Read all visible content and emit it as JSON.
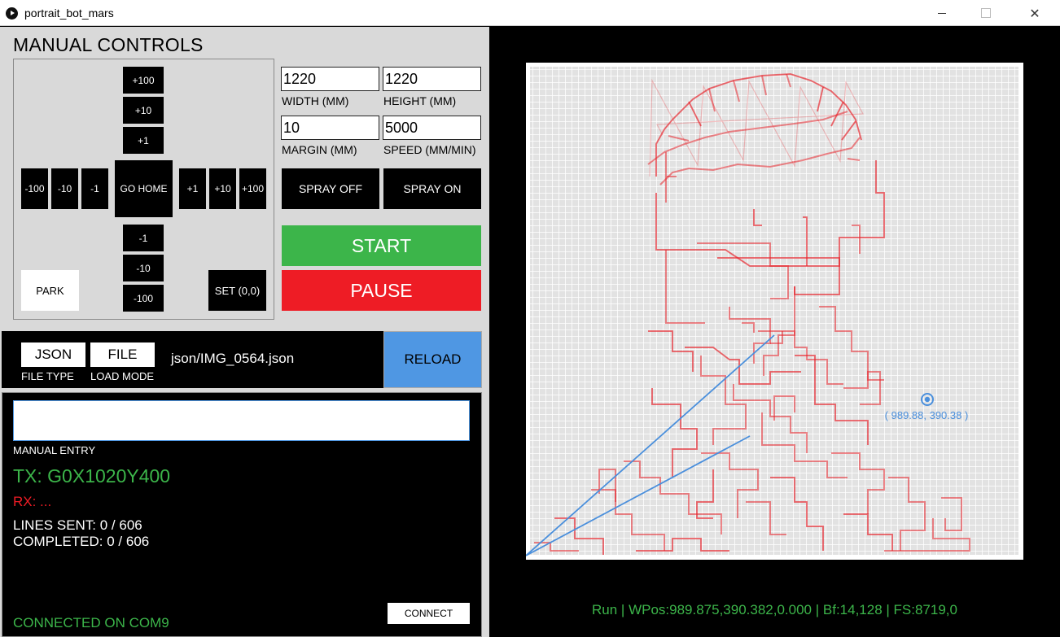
{
  "window": {
    "title": "portrait_bot_mars"
  },
  "manual": {
    "title": "MANUAL CONTROLS",
    "jog_up": [
      "+100",
      "+10",
      "+1"
    ],
    "jog_down": [
      "-1",
      "-10",
      "-100"
    ],
    "jog_left": [
      "-100",
      "-10",
      "-1"
    ],
    "jog_right": [
      "+1",
      "+10",
      "+100"
    ],
    "home_label": "GO HOME",
    "park_label": "PARK",
    "set_origin_label": "SET (0,0)"
  },
  "settings": {
    "width_value": "1220",
    "width_label": "WIDTH (MM)",
    "height_value": "1220",
    "height_label": "HEIGHT (MM)",
    "margin_value": "10",
    "margin_label": "MARGIN (MM)",
    "speed_value": "5000",
    "speed_label": "SPEED (MM/MIN)",
    "spray_off_label": "SPRAY OFF",
    "spray_on_label": "SPRAY ON",
    "start_label": "START",
    "pause_label": "PAUSE",
    "start_color": "#3cb54a",
    "pause_color": "#ee1c25"
  },
  "file": {
    "type_value": "JSON",
    "type_label": "FILE TYPE",
    "mode_value": "FILE",
    "mode_label": "LOAD MODE",
    "path": "json/IMG_0564.json",
    "reload_label": "RELOAD"
  },
  "console": {
    "manual_entry_value": "",
    "manual_entry_label": "MANUAL ENTRY",
    "tx": "TX: G0X1020Y400",
    "rx": "RX: ...",
    "lines_sent": "LINES SENT: 0 / 606",
    "completed": "COMPLETED: 0 / 606",
    "connect_label": "CONNECT",
    "connection_status": "CONNECTED ON COM9"
  },
  "preview": {
    "cursor_readout": "( 989.88, 390.38 )",
    "status": "Run | WPos:989.875,390.382,0.000 | Bf:14,128 | FS:8719,0",
    "path_color": "#e8262d",
    "belt_color": "#4a8fdc"
  }
}
